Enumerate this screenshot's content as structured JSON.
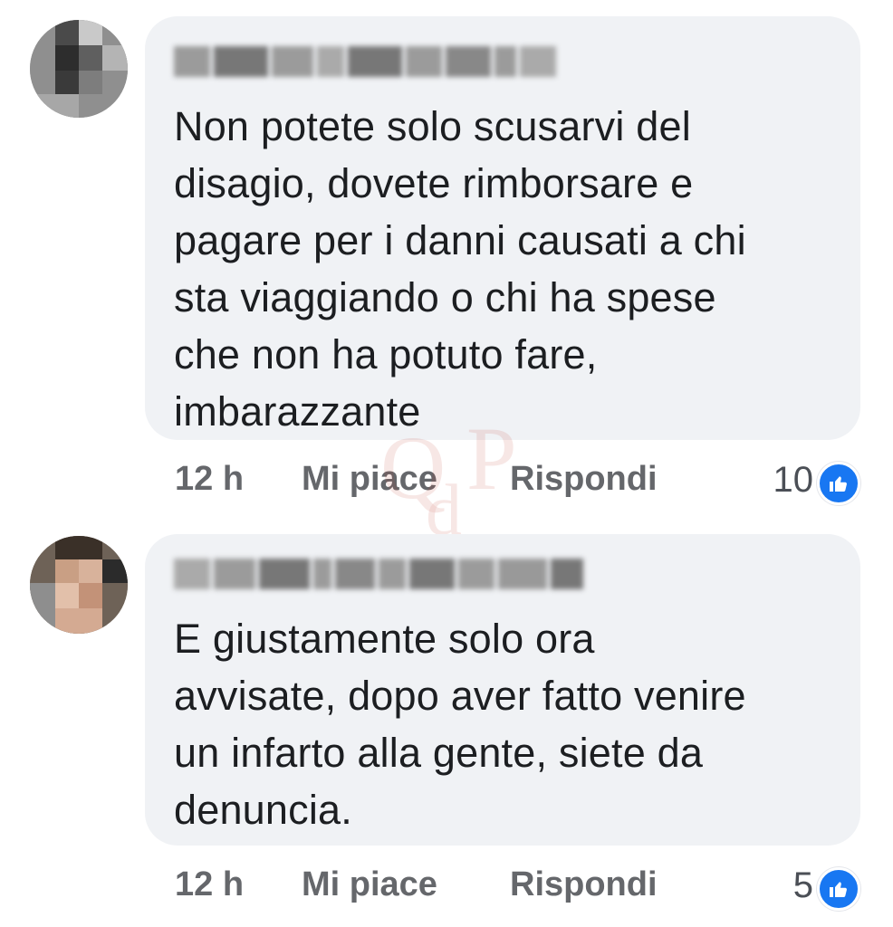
{
  "comments": [
    {
      "text": "Non potete solo scusarvi del disagio, dovete rimborsare e pagare per i danni causati a chi sta viaggiando o chi ha spese che non ha potuto fare, imbarazzante",
      "lines": [
        "Non potete solo scusarvi del",
        "disagio, dovete rimborsare e",
        "pagare per i danni causati a chi",
        "sta viaggiando o chi ha spese",
        "che non ha potuto fare,",
        "imbarazzante"
      ],
      "time": "12 h",
      "like_label": "Mi piace",
      "reply_label": "Rispondi",
      "reaction_count": "10",
      "reaction_icon": "thumbs-up-icon"
    },
    {
      "text": "E giustamente solo ora avvisate, dopo aver fatto venire un infarto alla gente, siete da denuncia.",
      "lines": [
        "E giustamente solo ora",
        "avvisate, dopo aver fatto venire",
        "un infarto alla gente, siete da",
        "denuncia."
      ],
      "time": "12 h",
      "like_label": "Mi piace",
      "reply_label": "Rispondi",
      "reaction_count": "5",
      "reaction_icon": "thumbs-up-icon"
    }
  ],
  "colors": {
    "bubble": "#f0f2f5",
    "text": "#1c1e21",
    "meta": "#65676b",
    "reaction": "#1877f2",
    "watermark": "#c0392b"
  },
  "watermark_text": {
    "q": "Q",
    "d": "d",
    "p": "P"
  }
}
